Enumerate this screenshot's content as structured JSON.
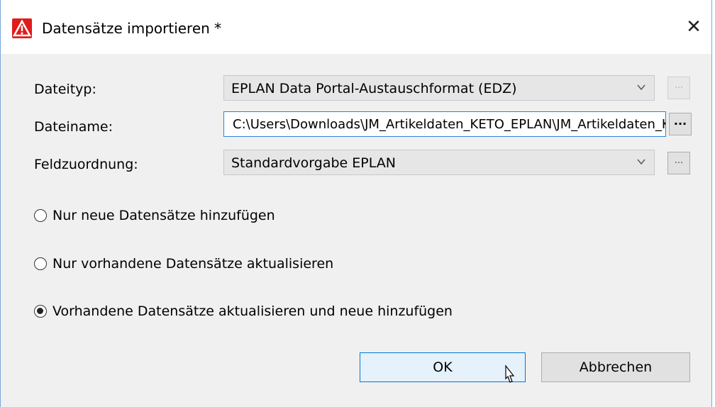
{
  "window": {
    "title": "Datensätze importieren *",
    "close_glyph": "✕",
    "app_icon": "eplan-warning-icon"
  },
  "form": {
    "filetype_label": "Dateityp:",
    "filetype_value": "EPLAN Data Portal-Austauschformat (EDZ)",
    "filename_label": "Dateiname:",
    "filename_value": "C:\\Users\\Downloads\\JM_Artikeldaten_KETO_EPLAN\\JM_Artikeldaten_KETO_EPLAN.edz",
    "mapping_label": "Feldzuordnung:",
    "mapping_value": "Standardvorgabe EPLAN",
    "browse_label": "..."
  },
  "options": [
    {
      "label": "Nur neue Datensätze hinzufügen",
      "checked": false
    },
    {
      "label": "Nur vorhandene Datensätze aktualisieren",
      "checked": false
    },
    {
      "label": "Vorhandene Datensätze aktualisieren und neue hinzufügen",
      "checked": true
    }
  ],
  "buttons": {
    "ok": "OK",
    "cancel": "Abbrechen"
  },
  "colors": {
    "accent": "#0078d7",
    "app_icon": "#e01b1b"
  }
}
